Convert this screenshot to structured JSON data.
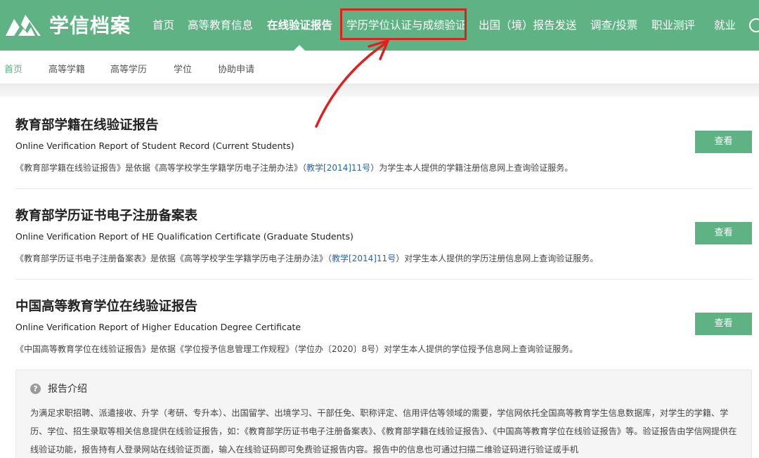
{
  "header": {
    "logo_text": "学信档案",
    "nav": [
      {
        "label": "首页"
      },
      {
        "label": "高等教育信息"
      },
      {
        "label": "在线验证报告"
      },
      {
        "label": "学历学位认证与成绩验证"
      },
      {
        "label": "出国（境）报告发送"
      },
      {
        "label": "调查/投票"
      },
      {
        "label": "职业测评"
      },
      {
        "label": "就业"
      }
    ]
  },
  "subnav": [
    {
      "label": "首页"
    },
    {
      "label": "高等学籍"
    },
    {
      "label": "高等学历"
    },
    {
      "label": "学位"
    },
    {
      "label": "协助申请"
    }
  ],
  "reports": [
    {
      "title": "教育部学籍在线验证报告",
      "subtitle": "Online Verification Report of Student Record (Current Students)",
      "desc_pre": "《教育部学籍在线验证报告》是依据《高等学校学生学籍学历电子注册办法》（",
      "desc_link": "教学[2014]11号",
      "desc_post": "）为学生本人提供的学籍注册信息网上查询验证服务。",
      "button": "查看"
    },
    {
      "title": "教育部学历证书电子注册备案表",
      "subtitle": "Online Verification Report of HE Qualification Certificate (Graduate Students)",
      "desc_pre": "《教育部学历证书电子注册备案表》是依据《高等学校学生学籍学历电子注册办法》（",
      "desc_link": "教学[2014]11号",
      "desc_post": "）对学生本人提供的学历注册信息网上查询验证服务。",
      "button": "查看"
    },
    {
      "title": "中国高等教育学位在线验证报告",
      "subtitle": "Online Verification Report of Higher Education Degree Certificate",
      "desc_pre": "《中国高等教育学位在线验证报告》是依据《学位授予信息管理工作规程》（学位办〔2020〕8号）对学生本人提供的学位授予信息网上查询验证服务。",
      "desc_link": "",
      "desc_post": "",
      "button": "查看"
    }
  ],
  "intro": {
    "title": "报告介绍",
    "text": "为满足求职招聘、派遣接收、升学（考研、专升本）、出国留学、出境学习、干部任免、职称评定、信用评估等领域的需要，学信网依托全国高等教育学生信息数据库，对学生的学籍、学历、学位、招生录取等相关信息提供在线验证报告，如：《教育部学历证书电子注册备案表》、《教育部学籍在线验证报告》、《中国高等教育学位在线验证报告》等。验证报告由学信网提供在线验证功能，报告持有人登录网站在线验证页面，输入在线验证码即可免费验证报告内容。报告中的信息也可通过扫描二维验证码进行验证或手机"
  },
  "colors": {
    "brand_green": "#5fb283",
    "highlight_red": "#e0201f",
    "link_blue": "#2a63b0"
  }
}
